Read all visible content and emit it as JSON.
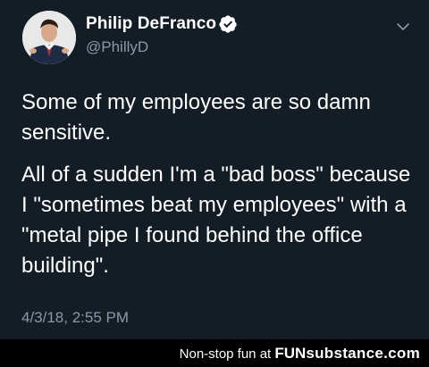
{
  "tweet": {
    "author": {
      "name": "Philip DeFranco",
      "handle": "@PhillyD",
      "avatar_icon": "profile-photo-avatar",
      "verified_icon": "verified-badge-icon"
    },
    "menu_icon": "chevron-down-icon",
    "paragraphs": [
      "Some of my employees are so damn sensitive.",
      "All of a sudden I'm a \"bad boss\" because I \"sometimes beat my employees\" with a \"metal pipe I found behind the office building\"."
    ],
    "timestamp": "4/3/18, 2:55 PM"
  },
  "footer": {
    "tagline": "Non-stop fun at",
    "brand_fun": "FUN",
    "brand_rest": "substance.com"
  },
  "colors": {
    "background": "#141d26",
    "secondary_text": "#8899a6",
    "verified_badge": "#ffffff",
    "footer_bg": "#000000"
  }
}
